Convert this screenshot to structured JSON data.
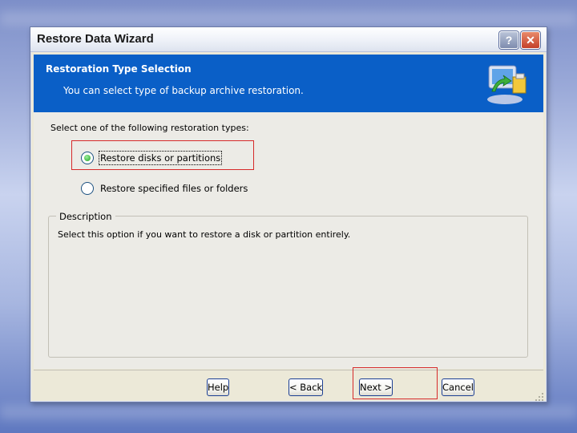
{
  "window": {
    "title": "Restore Data Wizard",
    "help_button": "?",
    "close_button": "✕"
  },
  "header": {
    "title": "Restoration Type Selection",
    "subtitle": "You can select type of backup archive restoration."
  },
  "prompt": "Select one of the following restoration types:",
  "options": [
    {
      "label": "Restore disks or partitions",
      "selected": true
    },
    {
      "label": "Restore specified files or folders",
      "selected": false
    }
  ],
  "description": {
    "legend": "Description",
    "text": "Select this option if you want to restore a disk or partition entirely."
  },
  "buttons": {
    "help": "Help",
    "back": "< Back",
    "next": "Next >",
    "cancel": "Cancel"
  },
  "colors": {
    "header_bg": "#0a5fc7",
    "highlight": "#d62a2a",
    "dialog_bg": "#ecebe6"
  }
}
